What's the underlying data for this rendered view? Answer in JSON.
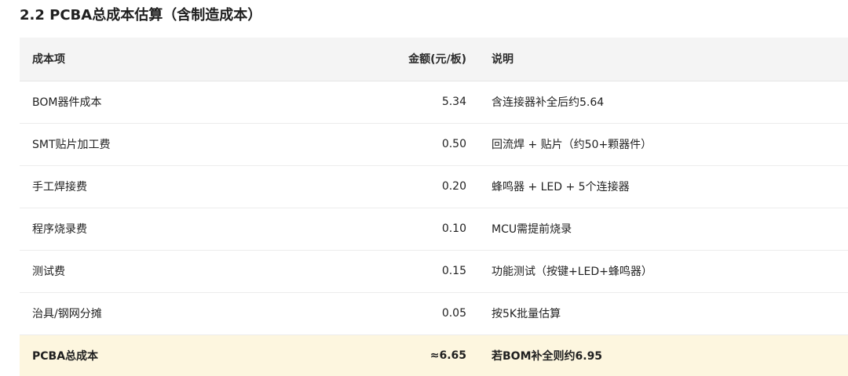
{
  "section": {
    "title": "2.2 PCBA总成本估算（含制造成本）"
  },
  "table": {
    "headers": {
      "item": "成本项",
      "amount": "金额(元/板)",
      "note": "说明"
    },
    "rows": [
      {
        "item": "BOM器件成本",
        "amount": "5.34",
        "note": "含连接器补全后约5.64"
      },
      {
        "item": "SMT贴片加工费",
        "amount": "0.50",
        "note": "回流焊 + 贴片（约50+颗器件）"
      },
      {
        "item": "手工焊接费",
        "amount": "0.20",
        "note": "蜂鸣器 + LED + 5个连接器"
      },
      {
        "item": "程序烧录费",
        "amount": "0.10",
        "note": "MCU需提前烧录"
      },
      {
        "item": "测试费",
        "amount": "0.15",
        "note": "功能测试（按键+LED+蜂鸣器）"
      },
      {
        "item": "治具/钢网分摊",
        "amount": "0.05",
        "note": "按5K批量估算"
      }
    ],
    "total": {
      "item": "PCBA总成本",
      "amount": "≈6.65",
      "note": "若BOM补全则约6.95"
    },
    "colors": {
      "header_bg": "#f4f4f4",
      "total_bg": "#fdf6df"
    }
  }
}
